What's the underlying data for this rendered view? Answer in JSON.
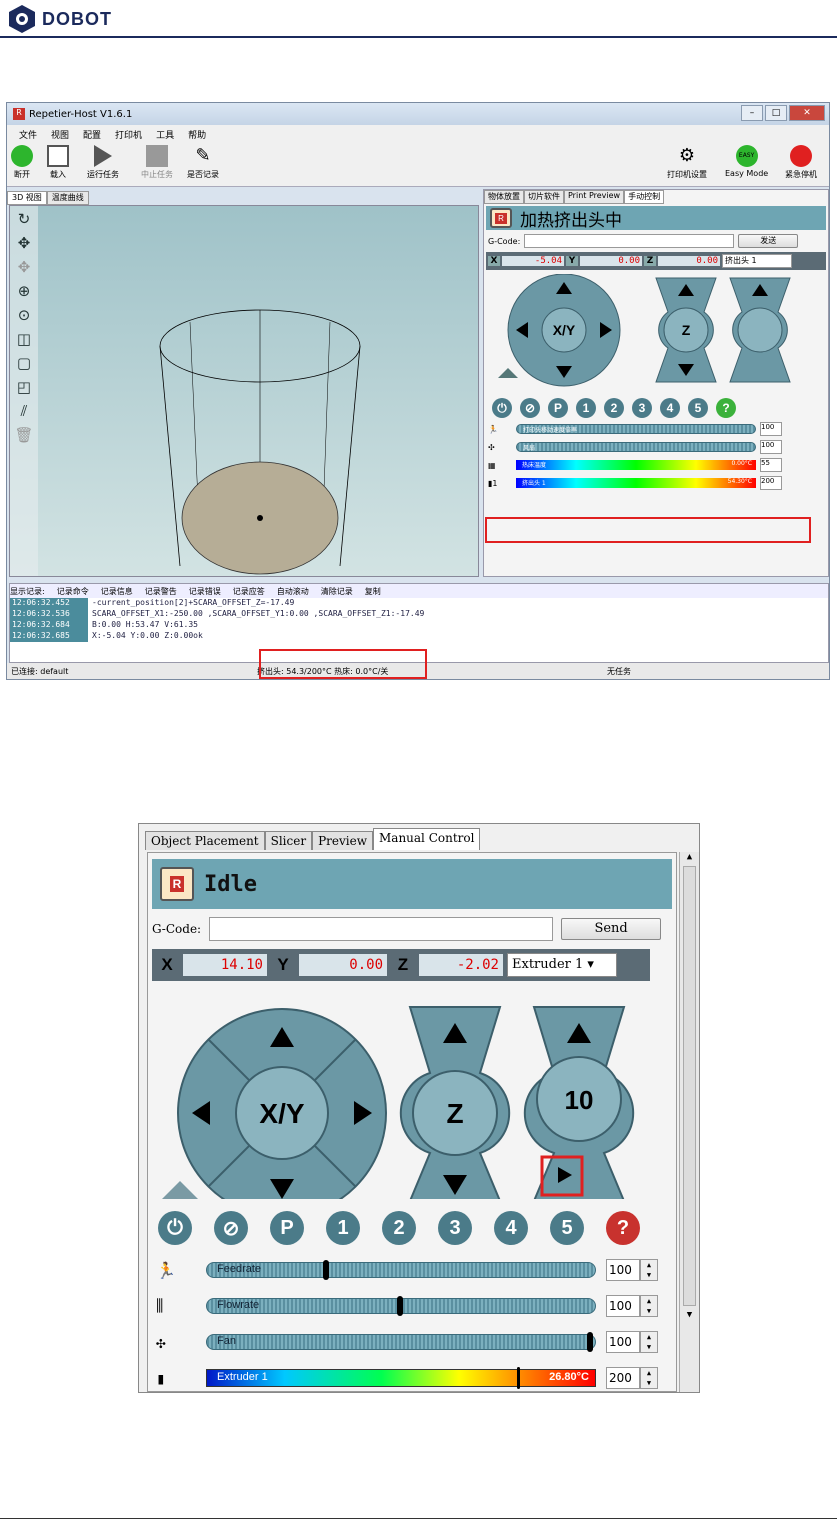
{
  "header": {
    "brand": "DOBOT"
  },
  "window1": {
    "title": "Repetier-Host V1.6.1",
    "menu": [
      "文件",
      "视图",
      "配置",
      "打印机",
      "工具",
      "帮助"
    ],
    "toolbar": [
      "断开",
      "载入",
      "运行任务",
      "中止任务",
      "是否记录"
    ],
    "toolbar_right": [
      "打印机设置",
      "Easy Mode",
      "紧急停机"
    ],
    "easy_badge": "EASY",
    "left_tabs": [
      "3D 视图",
      "温度曲线"
    ],
    "right_tabs": [
      "物体放置",
      "切片软件",
      "Print Preview",
      "手动控制"
    ],
    "status": "加热挤出头中",
    "gcode_label": "G-Code:",
    "send": "发送",
    "x_label": "X",
    "x": "-5.04",
    "y_label": "Y",
    "y": "0.00",
    "z_label": "Z",
    "z": "0.00",
    "extruder_select": "挤出头 1",
    "jog_labels": [
      "X/Y",
      "Z"
    ],
    "numbers": [
      "1",
      "2",
      "3",
      "4",
      "5"
    ],
    "p": "P",
    "help": "?",
    "sliders": [
      {
        "label": "打印头移动速度倍率",
        "value": "100"
      },
      {
        "label": "风扇",
        "value": "100"
      },
      {
        "label": "热床温度",
        "value": "55",
        "reading": "0.00°C"
      },
      {
        "label": "挤出头 1",
        "value": "200",
        "reading": "54.30°C",
        "idx": "1"
      }
    ],
    "log_options": [
      "显示记录:",
      "记录命令",
      "记录信息",
      "记录警告",
      "记录错误",
      "记录应答",
      "自动滚动",
      "清除记录",
      "复制"
    ],
    "log": [
      {
        "t": "12:06:32.452",
        "m": "-current_position[2]+SCARA_OFFSET_Z=-17.49"
      },
      {
        "t": "12:06:32.536",
        "m": "SCARA_OFFSET_X1:-250.00 ,SCARA_OFFSET_Y1:0.00 ,SCARA_OFFSET_Z1:-17.49"
      },
      {
        "t": "12:06:32.684",
        "m": "B:0.00    H:53.47   V:61.35"
      },
      {
        "t": "12:06:32.685",
        "m": "X:-5.04 Y:0.00 Z:0.00ok"
      }
    ],
    "statusbar": {
      "left": "已连接: default",
      "mid": "挤出头: 54.3/200°C 热床: 0.0°C/关",
      "right": "无任务"
    }
  },
  "window2": {
    "tabs": [
      "Object Placement",
      "Slicer",
      "Preview",
      "Manual Control"
    ],
    "status": "Idle",
    "gcode_label": "G-Code:",
    "send": "Send",
    "x_label": "X",
    "x": "14.10",
    "y_label": "Y",
    "y": "0.00",
    "z_label": "Z",
    "z": "-2.02",
    "extruder_select": "Extruder 1",
    "xy": "X/Y",
    "z_btn": "Z",
    "ext_step": "10",
    "p": "P",
    "numbers": [
      "1",
      "2",
      "3",
      "4",
      "5"
    ],
    "help": "?",
    "sliders": [
      {
        "label": "Feedrate",
        "value": "100",
        "level": 0.31
      },
      {
        "label": "Flowrate",
        "value": "100",
        "level": 0.5
      },
      {
        "label": "Fan",
        "value": "100",
        "level": 1.0
      },
      {
        "label": "Extruder 1",
        "value": "200",
        "reading": "26.80°C",
        "level": 0.81
      }
    ]
  },
  "colors": {
    "brand": "#1b2a5c",
    "panel_teal": "#6ea5b3",
    "highlight_red": "#e02020"
  }
}
